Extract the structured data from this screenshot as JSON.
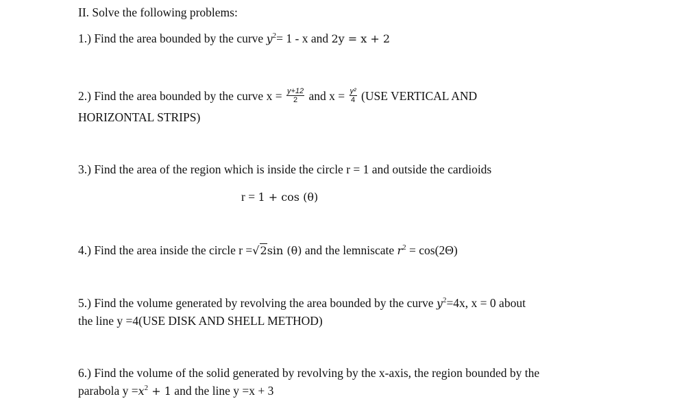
{
  "heading": "II. Solve the following problems:",
  "problems": [
    {
      "number": "1.)",
      "text_a": "Find the area bounded by the curve ",
      "eq1_base": "y",
      "eq1_exp": "2",
      "eq1_rest": "= 1 - x and ",
      "eq2": "2y = x + 2"
    },
    {
      "number": "2.)",
      "text_a": "Find the area bounded by the curve x = ",
      "frac1_num": "y+12",
      "frac1_den": "2",
      "text_b": " and x = ",
      "frac2_num": "y²",
      "frac2_den": "4",
      "text_c": " (USE VERTICAL AND",
      "line2": "HORIZONTAL STRIPS)"
    },
    {
      "number": "3.)",
      "text_a": "Find the area of the region which is inside the circle r = 1 and outside the cardioids",
      "eq_prefix": "r = ",
      "eq": "1 + cos (θ)"
    },
    {
      "number": "4.)",
      "text_a": "Find the area inside the circle r =",
      "sqrt_arg": "2",
      "text_b": "sin (θ)",
      "text_c": " and the lemniscate ",
      "lem_base": "r",
      "lem_exp": "2",
      "lem_rest": " = cos(2Θ)"
    },
    {
      "number": "5.)",
      "text_a": "Find the volume generated by revolving the area bounded by the curve ",
      "eq_base": "y",
      "eq_exp": "2",
      "eq_rest": "=4x, x = 0 about",
      "line2": "the line y =4(USE DISK AND SHELL METHOD)"
    },
    {
      "number": "6.)",
      "text_a": "Find the volume of the solid generated by revolving by the x-axis, the region bounded by the",
      "line2_a": "parabola y =",
      "para_base": "x",
      "para_exp": "2",
      "para_rest": " + 1",
      "line2_b": " and the line y =x + 3"
    }
  ]
}
